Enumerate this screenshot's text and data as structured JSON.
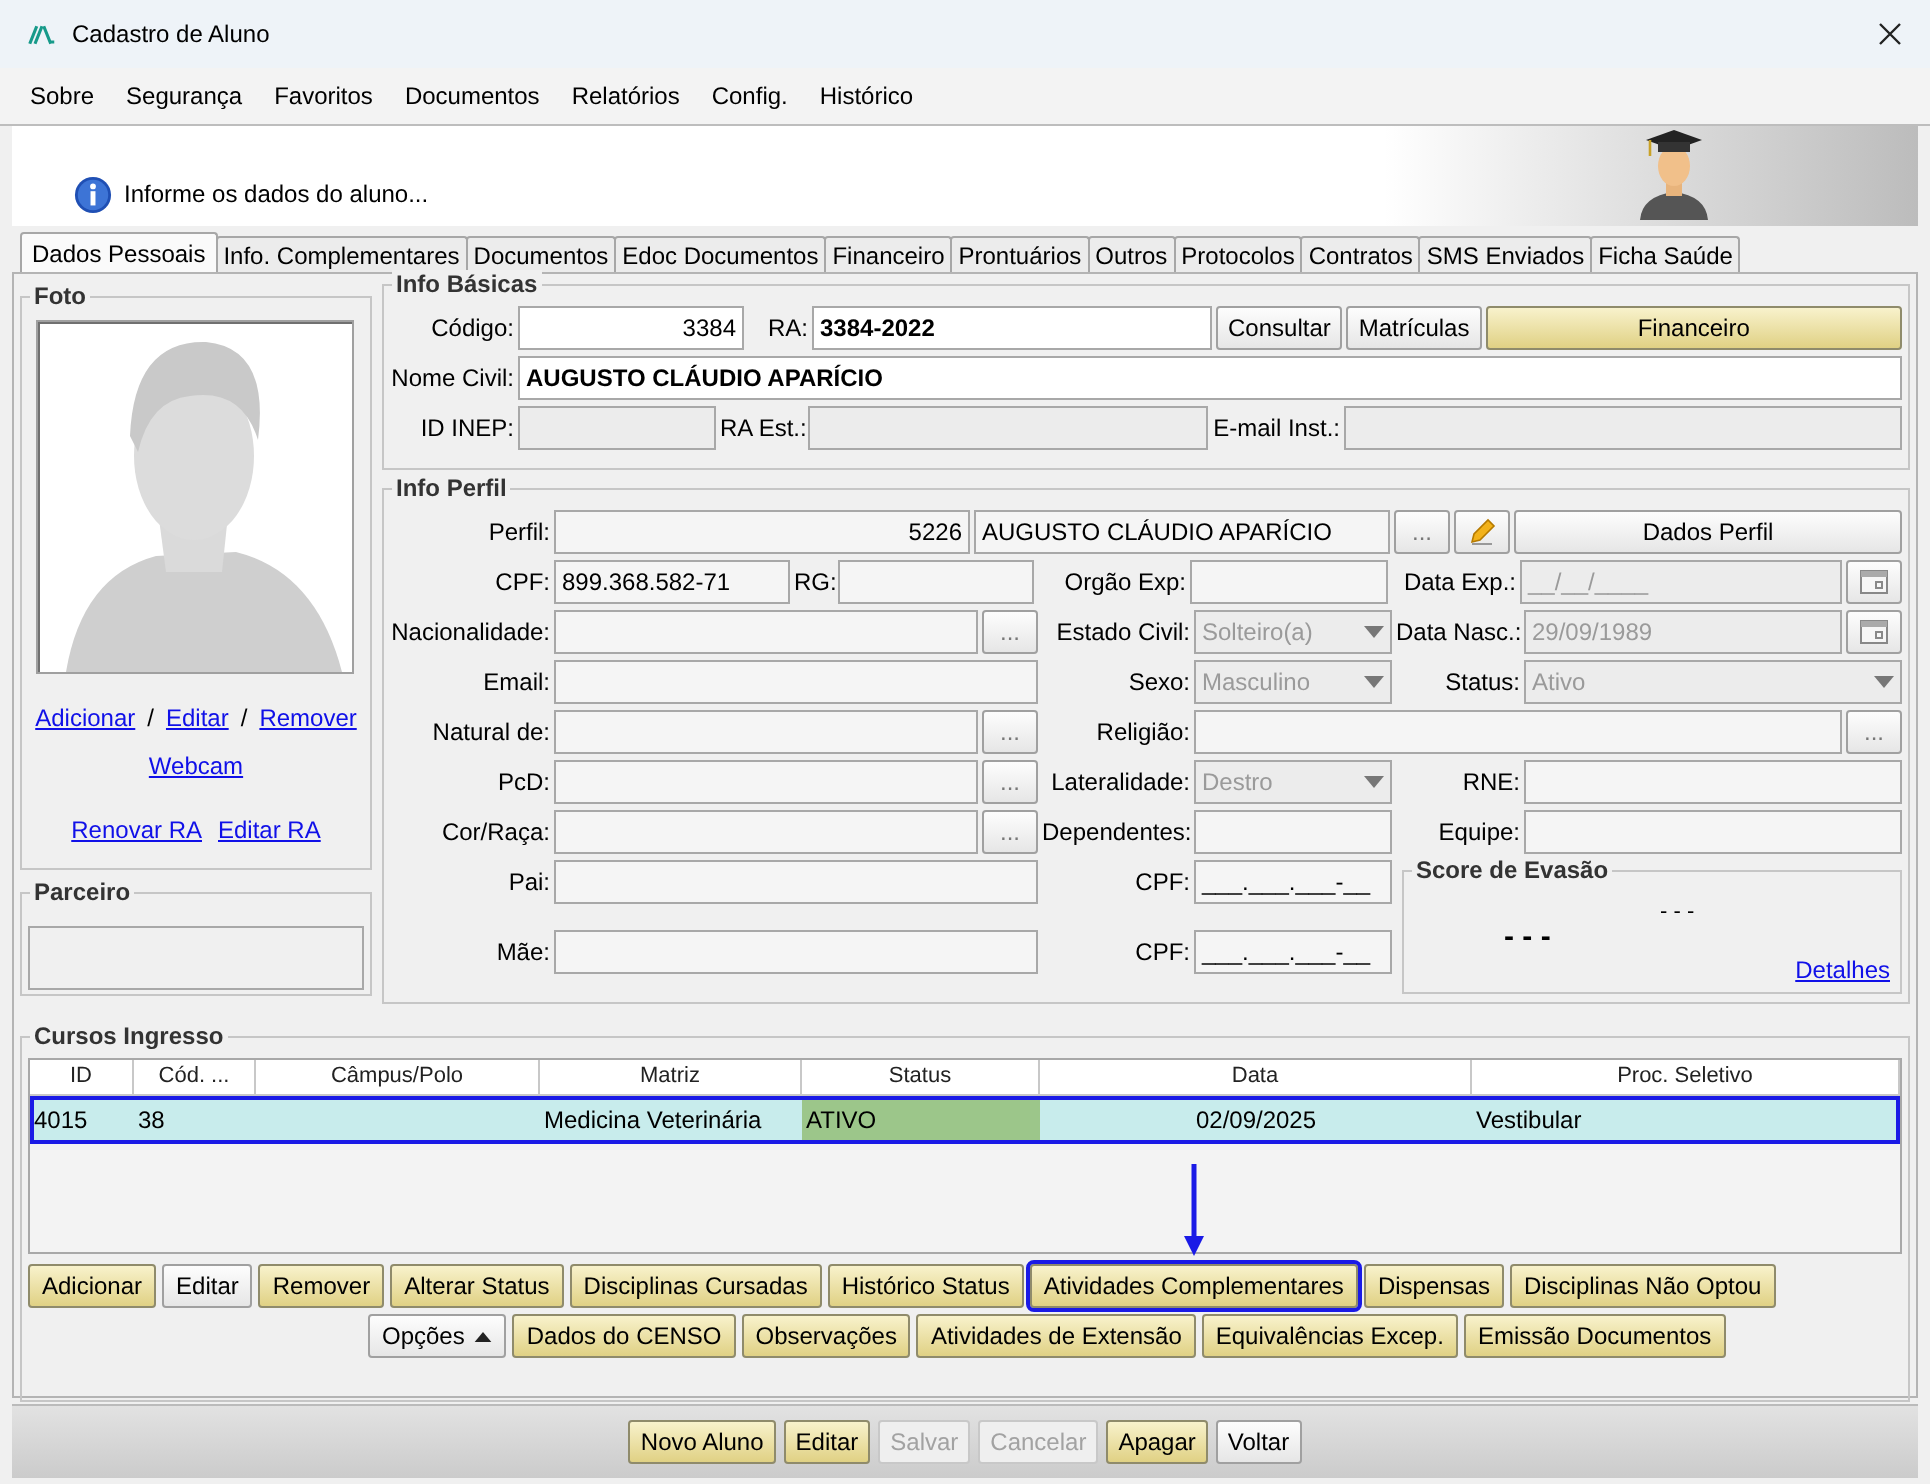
{
  "window": {
    "title": "Cadastro de Aluno"
  },
  "menu": [
    "Sobre",
    "Segurança",
    "Favoritos",
    "Documentos",
    "Relatórios",
    "Config.",
    "Histórico"
  ],
  "header": {
    "message": "Informe os dados do aluno..."
  },
  "tabs": [
    {
      "label": "Dados Pessoais",
      "selected": true
    },
    {
      "label": "Info. Complementares",
      "selected": false
    },
    {
      "label": "Documentos",
      "selected": false
    },
    {
      "label": "Edoc Documentos",
      "selected": false
    },
    {
      "label": "Financeiro",
      "selected": false
    },
    {
      "label": "Prontuários",
      "selected": false
    },
    {
      "label": "Outros",
      "selected": false
    },
    {
      "label": "Protocolos",
      "selected": false
    },
    {
      "label": "Contratos",
      "selected": false
    },
    {
      "label": "SMS Enviados",
      "selected": false
    },
    {
      "label": "Ficha Saúde",
      "selected": false
    }
  ],
  "foto": {
    "title": "Foto",
    "link_lines": [
      [
        {
          "kind": "link",
          "text": "Adicionar"
        },
        {
          "kind": "separator",
          "text": "/"
        },
        {
          "kind": "link",
          "text": "Editar"
        },
        {
          "kind": "separator",
          "text": "/"
        },
        {
          "kind": "link",
          "text": "Remover"
        }
      ],
      [
        {
          "kind": "link",
          "text": "Webcam"
        }
      ],
      [
        {
          "kind": "link",
          "text": "Renovar RA"
        },
        {
          "kind": "link",
          "text": "Editar RA"
        }
      ]
    ]
  },
  "parceiro": {
    "title": "Parceiro"
  },
  "info_basicas": {
    "title": "Info Básicas",
    "codigo": {
      "label": "Código:",
      "value": "3384",
      "kind": "text",
      "disabled": false
    },
    "ra": {
      "label": "RA:",
      "value": "3384-2022",
      "kind": "text",
      "disabled": false
    },
    "buttons": [
      {
        "label": "Consultar",
        "kind": "plain"
      },
      {
        "label": "Matrículas",
        "kind": "plain"
      },
      {
        "label": "Financeiro",
        "kind": "primary"
      }
    ],
    "nome_civil": {
      "label": "Nome Civil:",
      "value": "AUGUSTO CLÁUDIO APARÍCIO",
      "kind": "text",
      "disabled": false
    },
    "id_inep": {
      "label": "ID INEP:",
      "kind": "text",
      "disabled": true
    },
    "ra_est": {
      "label": "RA Est.:",
      "kind": "text",
      "disabled": true
    },
    "email_inst": {
      "label": "E-mail Inst.:",
      "kind": "text",
      "disabled": true
    }
  },
  "info_perfil": {
    "title": "Info Perfil",
    "perfil": {
      "label": "Perfil:",
      "code": "5226",
      "name": "AUGUSTO CLÁUDIO APARÍCIO",
      "button": "...",
      "action": "Dados Perfil"
    },
    "rows": [
      {
        "left": [
          {
            "label": "CPF:",
            "value": "899.368.582-71",
            "kind": "text",
            "disabled": false
          },
          {
            "label": "RG:",
            "kind": "text"
          }
        ],
        "middle": {
          "label": "Orgão Exp:",
          "kind": "text"
        },
        "right": {
          "label": "Data Exp.:",
          "value": "__/__/____",
          "kind": "date",
          "disabled": true
        }
      },
      {
        "left": [
          {
            "label": "Nacionalidade:",
            "kind": "lookup",
            "button": "..."
          }
        ],
        "middle": {
          "label": "Estado Civil:",
          "value": "Solteiro(a)",
          "kind": "dropdown",
          "disabled": true
        },
        "right": {
          "label": "Data Nasc.:",
          "value": "29/09/1989",
          "kind": "date",
          "disabled": true
        }
      },
      {
        "left": [
          {
            "label": "Email:",
            "kind": "text"
          }
        ],
        "middle": {
          "label": "Sexo:",
          "value": "Masculino",
          "kind": "dropdown",
          "disabled": true
        },
        "right": {
          "label": "Status:",
          "value": "Ativo",
          "kind": "dropdown",
          "disabled": true
        }
      },
      {
        "left": [
          {
            "label": "Natural de:",
            "kind": "lookup",
            "button": "..."
          }
        ],
        "middle": {
          "label": "Religião:",
          "kind": "lookup",
          "button": "..."
        }
      },
      {
        "left": [
          {
            "label": "PcD:",
            "kind": "lookup",
            "button": "..."
          }
        ],
        "middle": {
          "label": "Lateralidade:",
          "value": "Destro",
          "kind": "dropdown",
          "disabled": true
        },
        "right": {
          "label": "RNE:",
          "kind": "text"
        }
      },
      {
        "left": [
          {
            "label": "Cor/Raça:",
            "kind": "lookup",
            "button": "..."
          }
        ],
        "middle": {
          "label": "Dependentes:",
          "kind": "text"
        },
        "right": {
          "label": "Equipe:",
          "kind": "text"
        }
      }
    ],
    "lower_rows": [
      {
        "left": [
          {
            "label": "Pai:",
            "kind": "text"
          }
        ],
        "middle": {
          "label": "CPF:",
          "value": "___.___.___-__",
          "kind": "text",
          "disabled": false
        }
      },
      {
        "left": [
          {
            "label": "Mãe:",
            "kind": "text"
          }
        ],
        "middle": {
          "label": "CPF:",
          "value": "___.___.___-__",
          "kind": "text",
          "disabled": false
        }
      }
    ],
    "score": {
      "title": "Score de Evasão",
      "main": "- - -",
      "secondary": "- - -",
      "link": "Detalhes"
    }
  },
  "cursos": {
    "title": "Cursos Ingresso",
    "columns": [
      "ID",
      "Cód. ...",
      "Câmpus/Polo",
      "Matriz",
      "Status",
      "Data",
      "Proc. Seletivo"
    ],
    "rows": [
      {
        "selected": true,
        "cells": [
          {
            "text": "4015"
          },
          {
            "text": "38"
          },
          {},
          {
            "text": "Medicina Veterinária"
          },
          {
            "text": "ATIVO",
            "color": "#9cc68a"
          },
          {
            "text": "02/09/2025"
          },
          {
            "text": "Vestibular"
          }
        ]
      }
    ],
    "button_rows": [
      [
        {
          "label": "Adicionar",
          "kind": "primary",
          "highlighted": false
        },
        {
          "label": "Editar",
          "kind": "plain",
          "highlighted": false
        },
        {
          "label": "Remover",
          "kind": "primary",
          "highlighted": false
        },
        {
          "label": "Alterar Status",
          "kind": "primary",
          "highlighted": false
        },
        {
          "label": "Disciplinas Cursadas",
          "kind": "primary",
          "highlighted": false
        },
        {
          "label": "Histórico Status",
          "kind": "primary",
          "highlighted": false
        },
        {
          "label": "Atividades Complementares",
          "kind": "primary",
          "highlighted": true
        },
        {
          "label": "Dispensas",
          "kind": "primary",
          "highlighted": false
        },
        {
          "label": "Disciplinas Não Optou",
          "kind": "primary",
          "highlighted": false
        }
      ],
      [
        {
          "label": "Opções",
          "kind": "menu",
          "highlighted": false
        },
        {
          "label": "Dados do CENSO",
          "kind": "primary",
          "highlighted": false
        },
        {
          "label": "Observações",
          "kind": "primary",
          "highlighted": false
        },
        {
          "label": "Atividades de Extensão",
          "kind": "primary",
          "highlighted": false
        },
        {
          "label": "Equivalências Excep.",
          "kind": "primary",
          "highlighted": false
        },
        {
          "label": "Emissão Documentos",
          "kind": "primary",
          "highlighted": false
        }
      ]
    ]
  },
  "footer_buttons": [
    {
      "label": "Novo Aluno",
      "kind": "primary",
      "disabled": false
    },
    {
      "label": "Editar",
      "kind": "primary",
      "disabled": false
    },
    {
      "label": "Salvar",
      "kind": "primary",
      "disabled": true
    },
    {
      "label": "Cancelar",
      "kind": "primary",
      "disabled": true
    },
    {
      "label": "Apagar",
      "kind": "primary",
      "disabled": false
    },
    {
      "label": "Voltar",
      "kind": "plain",
      "disabled": false
    }
  ]
}
